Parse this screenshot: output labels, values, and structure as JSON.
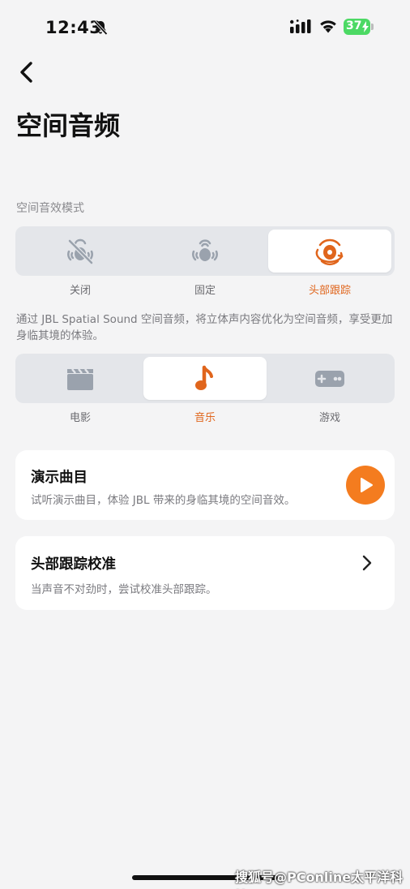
{
  "status_bar": {
    "time": "12:43",
    "battery": "37",
    "icons": [
      "bell-slash-icon",
      "signal-icon",
      "wifi-icon",
      "battery-charging-icon"
    ]
  },
  "header": {
    "back_icon": "chevron-left-icon",
    "title": "空间音频"
  },
  "mode_section": {
    "label": "空间音效模式",
    "options": [
      {
        "label": "关闭",
        "icon": "spatial-off-icon",
        "selected": false
      },
      {
        "label": "固定",
        "icon": "spatial-fixed-icon",
        "selected": false
      },
      {
        "label": "头部跟踪",
        "icon": "head-tracking-icon",
        "selected": true
      }
    ],
    "description": "通过 JBL Spatial Sound 空间音频，将立体声内容优化为空间音频，享受更加身临其境的体验。"
  },
  "content_section": {
    "options": [
      {
        "label": "电影",
        "icon": "movie-clapper-icon",
        "selected": false
      },
      {
        "label": "音乐",
        "icon": "music-note-icon",
        "selected": true
      },
      {
        "label": "游戏",
        "icon": "gamepad-icon",
        "selected": false
      }
    ]
  },
  "demo_card": {
    "title": "演示曲目",
    "subtitle": "试听演示曲目，体验 JBL 带来的身临其境的空间音效。",
    "icon": "play-icon"
  },
  "calibration_card": {
    "title": "头部跟踪校准",
    "subtitle": "当声音不对劲时，尝试校准头部跟踪。",
    "icon": "chevron-right-icon"
  },
  "watermark": "搜狐号@PConline太平洋科技",
  "colors": {
    "accent": "#e0651c",
    "play_button": "#f47c1f",
    "inactive_icon": "#9aa2ad",
    "background": "#f4f4f5",
    "segment_bg": "#e4e6ea"
  }
}
